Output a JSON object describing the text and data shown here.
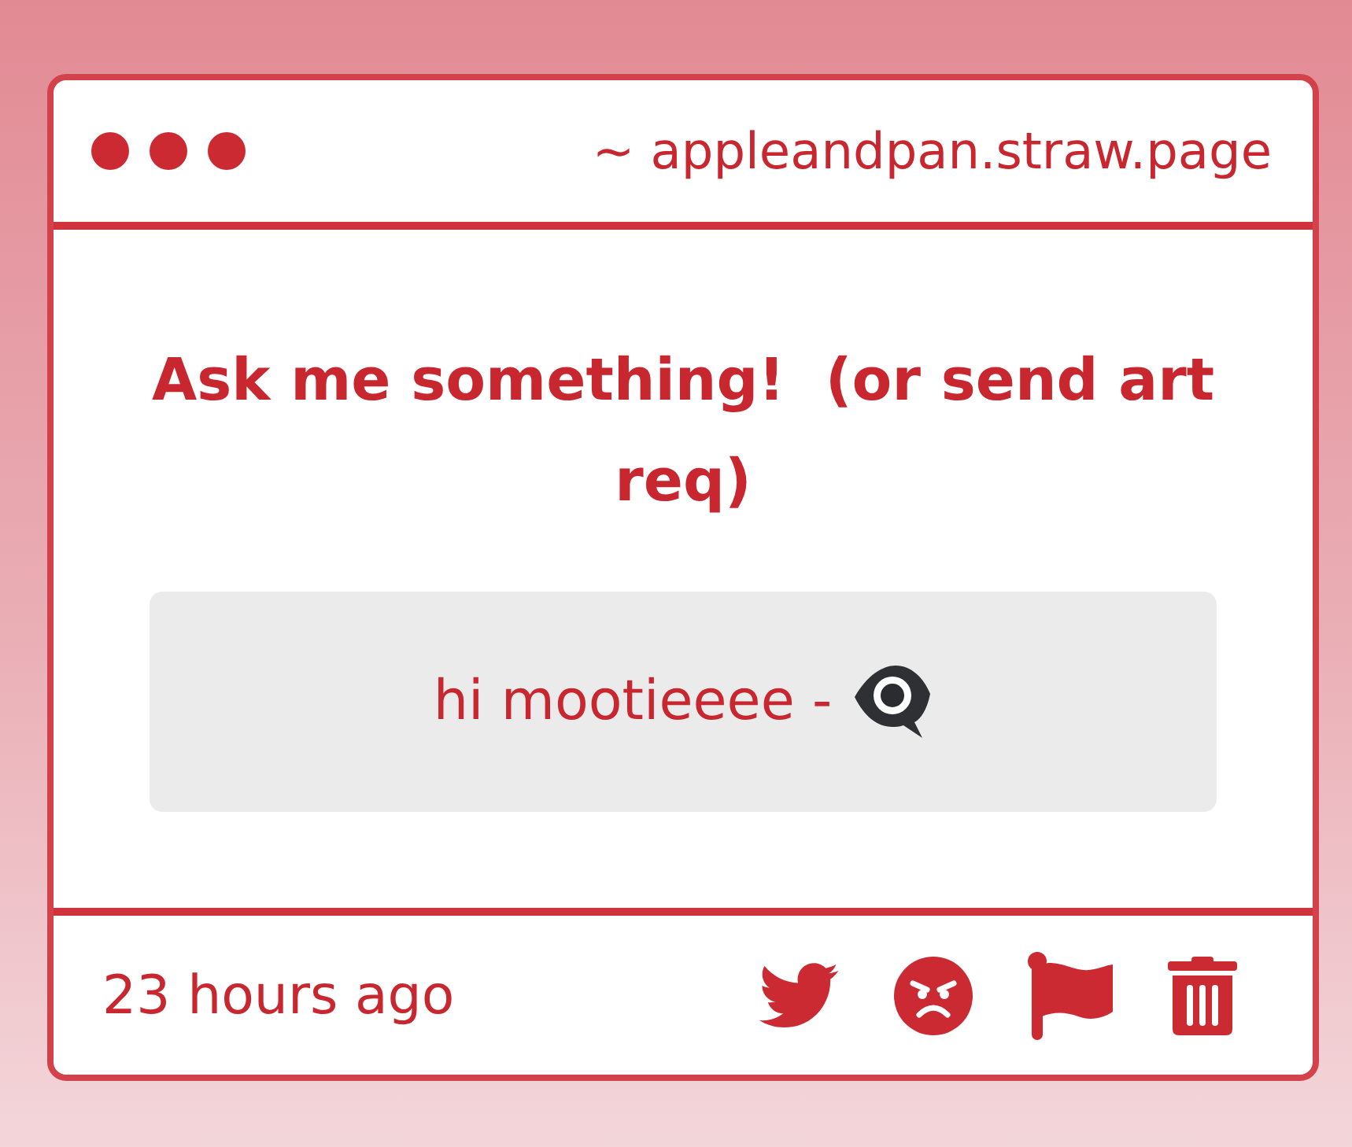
{
  "window": {
    "url": "~ appleandpan.straw.page"
  },
  "prompt": {
    "title": "Ask me something!  (or send art req)"
  },
  "question": {
    "text": "hi mootieeee -"
  },
  "footer": {
    "timestamp": "23 hours ago"
  }
}
